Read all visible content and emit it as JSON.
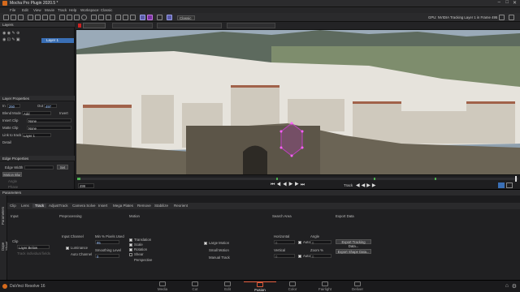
{
  "app": {
    "title": "Mocha Pro Plugin 2020.5 *"
  },
  "menu": [
    "File",
    "Edit",
    "View",
    "Movie",
    "Track",
    "Help"
  ],
  "workspace": {
    "label": "Workspace: Classic",
    "dropdown": "Classic"
  },
  "status_text": "GPU: NVIDIA Tracking Layer 1 in Frame 495",
  "layers": {
    "header": "Layers",
    "items": [
      {
        "name": "Layer 1"
      }
    ]
  },
  "layer_properties": {
    "header": "Layer Properties",
    "in_label": "In",
    "in_value": "250",
    "out_label": "Out",
    "out_value": "497",
    "blend_mode_label": "Blend Mode",
    "blend_mode_value": "Add",
    "invert_label": "Invert",
    "insert_clip_label": "Insert Clip",
    "insert_clip_value": "None",
    "matte_clip_label": "Matte Clip",
    "matte_clip_value": "None",
    "link_label": "Link to track",
    "link_value": "Layer 1",
    "detail_label": "Detail"
  },
  "edge_properties": {
    "header": "Edge Properties",
    "edge_width_label": "Edge Width",
    "set_label": "Set",
    "motion_blur_label": "Motion Blur",
    "angle_label": "Angle",
    "phase_label": "Phase",
    "quality_label": "Quality"
  },
  "viewer": {
    "sky_color": "#9aaab8",
    "mountain_color": "#5d6a5e",
    "town_color": "#e6e3dc",
    "cliff_color": "#6b6455",
    "track_shape_color": "#c040c0"
  },
  "timeline": {
    "frame_value": "499",
    "track_label": "Track"
  },
  "parameters": {
    "header": "Parameters",
    "tabs": [
      "Clip",
      "Lens",
      "Track",
      "AdjustTrack",
      "Camera Solve",
      "Insert",
      "Mega Plates",
      "Remove",
      "Stabilize",
      "Reorient"
    ],
    "active_tab": "Track",
    "side_tabs": [
      "Parameters",
      "Dope Sheet"
    ],
    "sections": {
      "input": "Input",
      "preprocessing": "Preprocessing",
      "motion": "Motion",
      "search_area": "Search Area",
      "export_data": "Export Data"
    },
    "clip_label": "Clip",
    "clip_value": "Layer Below",
    "track_individual": "Track individual fields",
    "input_channel_label": "Input Channel",
    "luminance_label": "Luminance",
    "auto_channel_label": "Auto Channel",
    "min_pixels_label": "Min % Pixels Used",
    "min_pixels_value": "95",
    "smoothing_label": "Smoothing Level",
    "smoothing_value": "0",
    "motion_options": [
      "Translation",
      "Scale",
      "Rotation",
      "Shear",
      "Perspective"
    ],
    "large_motion": "Large Motion",
    "small_motion": "Small Motion",
    "manual_track": "Manual Track",
    "horizontal_label": "Horizontal",
    "horizontal_value": "0",
    "vertical_label": "Vertical",
    "vertical_value": "0",
    "auto_label": "Auto",
    "angle_label": "Angle",
    "angle_value": "0",
    "zoom_label": "Zoom %",
    "zoom_value": "0",
    "export_tracking_button": "Export Tracking Data...",
    "export_shape_button": "Export Shape Data..."
  },
  "bottom_bar": {
    "brand": "DaVinci Resolve 16",
    "pages": [
      "Media",
      "Cut",
      "Edit",
      "Fusion",
      "Color",
      "Fairlight",
      "Deliver"
    ],
    "active_page": "Fusion"
  }
}
